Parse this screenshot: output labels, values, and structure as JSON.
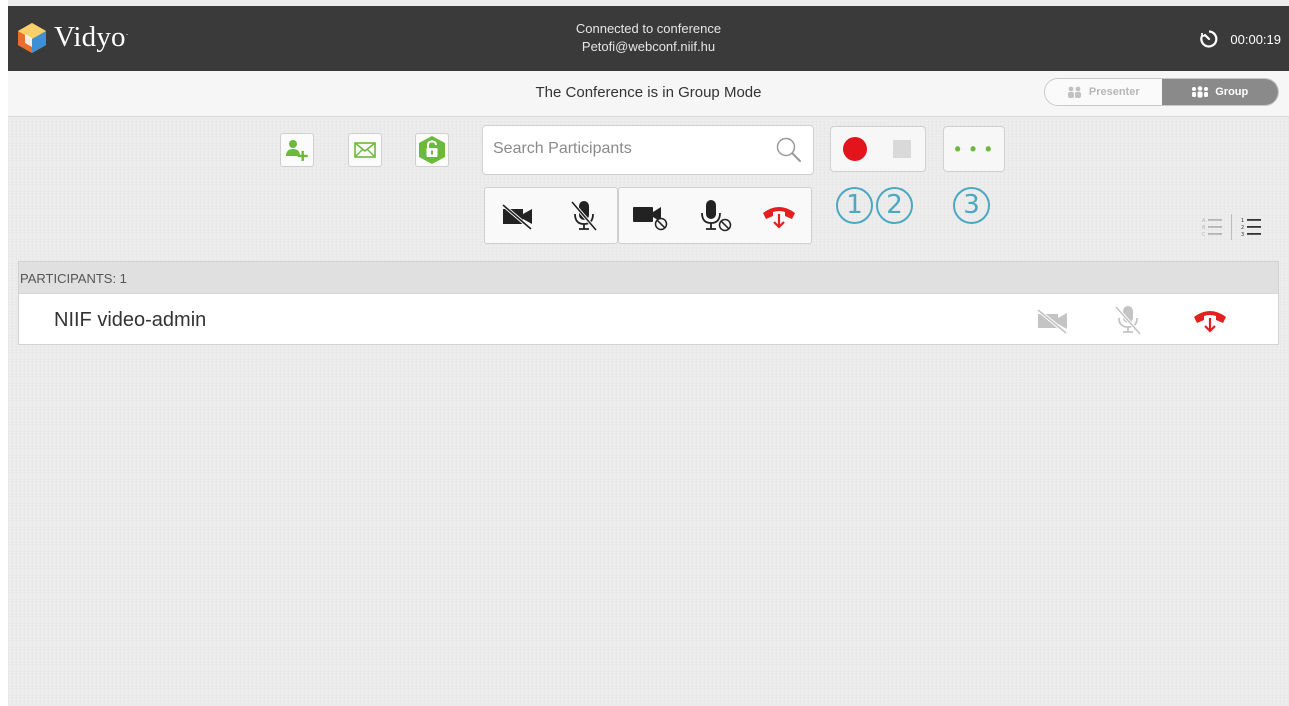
{
  "app": {
    "brand": "Vidyo",
    "connection_status": "Connected to conference",
    "conference_address": "Petofi@webconf.niif.hu",
    "timer": "00:00:19"
  },
  "mode": {
    "title": "The Conference is in Group Mode",
    "presenter_label": "Presenter",
    "group_label": "Group",
    "selected": "Group"
  },
  "toolbar": {
    "search_placeholder": "Search Participants",
    "more_label": "• • •",
    "annotations": [
      "1",
      "2",
      "3"
    ],
    "icons": [
      "add-participant-icon",
      "invite-email-icon",
      "lock-icon",
      "record-icon",
      "stop-icon",
      "more-icon"
    ]
  },
  "controls": {
    "mute_all": [
      "video-off-icon",
      "mic-off-icon"
    ],
    "lock_all": [
      "camera-block-icon",
      "mic-block-icon",
      "hangup-all-icon"
    ]
  },
  "participants": {
    "header": "PARTICIPANTS: 1",
    "list": [
      {
        "name": "NIIF video-admin"
      }
    ]
  },
  "colors": {
    "accent_green": "#6cba3a",
    "record_red": "#e3141b",
    "hangup_red": "#e32020",
    "annotation_blue": "#4aa8c2",
    "topbar_bg": "#3a3a3a"
  }
}
